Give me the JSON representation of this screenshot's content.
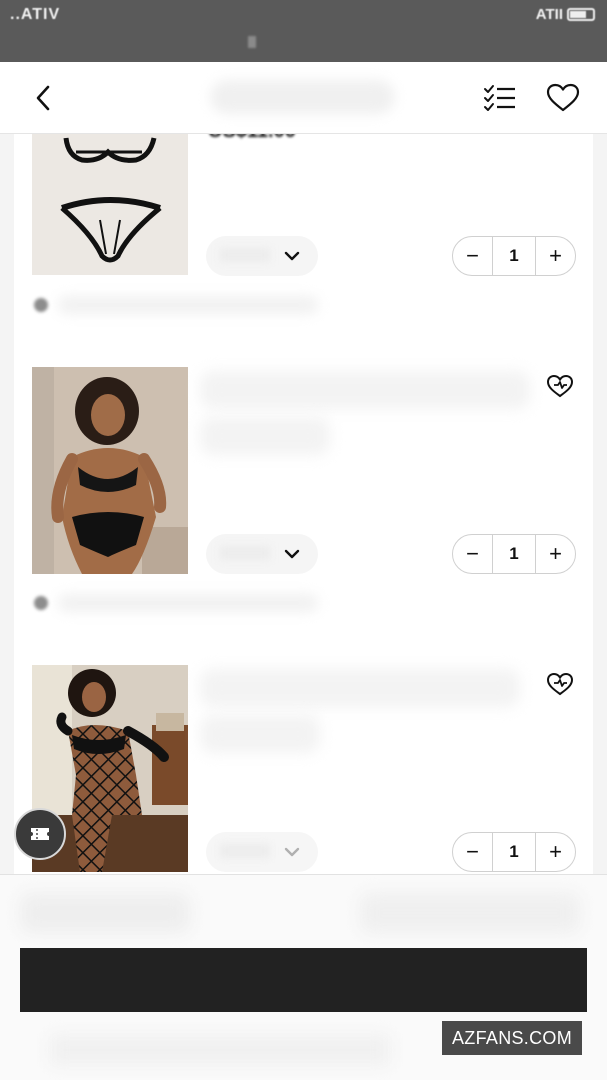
{
  "status_bar": {
    "left_text": "..ATIV",
    "right_text": "ATII"
  },
  "header": {
    "back_icon": "chevron-left-icon",
    "list_icon": "checklist-icon",
    "wishlist_icon": "heart-outline-icon"
  },
  "cart": {
    "items": [
      {
        "price_partial": "US$11.00",
        "quantity": "1",
        "variant_icon": "chevron-down-icon",
        "thumb": "black harness bra and thong on beige"
      },
      {
        "quantity": "1",
        "variant_icon": "chevron-down-icon",
        "wish_icon": "heart-plus-icon",
        "thumb": "model in black faux leather lace-up set"
      },
      {
        "quantity": "1",
        "variant_icon": "chevron-down-icon",
        "wish_icon": "heart-plus-icon",
        "thumb": "model in black fishnet bodystocking"
      }
    ],
    "qty_minus": "−",
    "qty_plus": "+"
  },
  "coupon_fab": {
    "icon": "ticket-icon"
  },
  "footer": {
    "checkout_label": ""
  },
  "watermark": "AZFANS.COM",
  "colors": {
    "status_bar": "#5a5a5a",
    "checkout": "#222222",
    "background": "#f4f4f4"
  }
}
